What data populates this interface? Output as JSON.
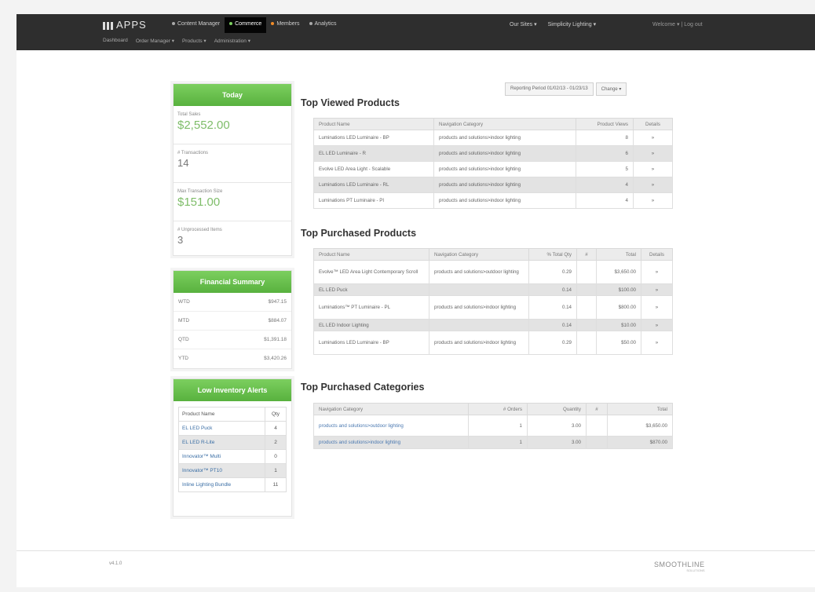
{
  "nav": {
    "logo": "APPS",
    "items": [
      {
        "label": "Content Manager",
        "dot_color": ""
      },
      {
        "label": "Commerce",
        "dot_color": "#7ccf5f",
        "active": true
      },
      {
        "label": "Members",
        "dot_color": "#f28c28"
      },
      {
        "label": "Analytics",
        "dot_color": ""
      }
    ],
    "right": [
      "Our Sites ▾",
      "Simplicity Lighting ▾"
    ],
    "user": "Welcome ▾ | Log out",
    "sub": [
      "Dashboard",
      "Order Manager ▾",
      "Products ▾",
      "Administration ▾"
    ]
  },
  "today": {
    "title": "Today",
    "stats": [
      {
        "label": "Total Sales",
        "value": "$2,552.00"
      },
      {
        "label": "# Transactions",
        "value": "14"
      },
      {
        "label": "Max Transaction Size",
        "value": "$151.00"
      },
      {
        "label": "# Unprocessed Items",
        "value": "3"
      }
    ]
  },
  "financial": {
    "title": "Financial Summary",
    "rows": [
      {
        "label": "WTD",
        "value": "$947.15"
      },
      {
        "label": "MTD",
        "value": "$884.07"
      },
      {
        "label": "QTD",
        "value": "$1,391.18"
      },
      {
        "label": "YTD",
        "value": "$3,420.26"
      }
    ]
  },
  "inventory": {
    "title": "Low Inventory Alerts",
    "col_name": "Product Name",
    "col_qty": "Qty",
    "rows": [
      {
        "name": "EL LED Puck",
        "qty": "4"
      },
      {
        "name": "EL LED R-Lite",
        "qty": "2"
      },
      {
        "name": "Innovator™ Multi",
        "qty": "0"
      },
      {
        "name": "Innovator™ PT10",
        "qty": "1"
      },
      {
        "name": "Inline Lighting Bundle",
        "qty": "11"
      }
    ]
  },
  "period": {
    "label": "Reporting Period 01/02/13 - 01/23/13",
    "change": "Change ▾"
  },
  "top_viewed": {
    "title": "Top Viewed Products",
    "headers": [
      "Product Name",
      "Navigation Category",
      "Product Views",
      "Details"
    ],
    "rows": [
      [
        "Luminations LED Luminaire - BP",
        "products and solutions>indoor lighting",
        "8",
        "»"
      ],
      [
        "EL LED Luminaire - R",
        "products and solutions>indoor lighting",
        "6",
        "»"
      ],
      [
        "Evolve LED Area Light - Scalable",
        "products and solutions>indoor lighting",
        "5",
        "»"
      ],
      [
        "Luminations LED Luminaire - RL",
        "products and solutions>indoor lighting",
        "4",
        "»"
      ],
      [
        "Luminations PT Luminaire - PI",
        "products and solutions>indoor lighting",
        "4",
        "»"
      ]
    ]
  },
  "top_purchased": {
    "title": "Top Purchased Products",
    "headers": [
      "Product Name",
      "Navigation Category",
      "% Total Qty",
      "#",
      "Total",
      "Details"
    ],
    "rows": [
      [
        "Evolve™ LED Area Light Contemporary Scroll",
        "products and solutions>outdoor lighting",
        "0.29",
        "",
        "$3,650.00",
        "»"
      ],
      [
        "EL LED Puck",
        "",
        "0.14",
        "",
        "$100.00",
        "»"
      ],
      [
        "Luminations™ PT Luminaire - PL",
        "products and solutions>indoor lighting",
        "0.14",
        "",
        "$800.00",
        "»"
      ],
      [
        "EL LED Indoor Lighting",
        "",
        "0.14",
        "",
        "$10.00",
        "»"
      ],
      [
        "Luminations LED Luminaire - BP",
        "products and solutions>indoor lighting",
        "0.29",
        "",
        "$50.00",
        "»"
      ]
    ]
  },
  "top_categories": {
    "title": "Top Purchased Categories",
    "headers": [
      "Navigation Category",
      "# Orders",
      "Quantity",
      "#",
      "Total"
    ],
    "rows": [
      [
        "products and solutions>outdoor lighting",
        "1",
        "3.00",
        "",
        "$3,650.00"
      ],
      [
        "products and solutions>indoor lighting",
        "1",
        "3.00",
        "",
        "$870.00"
      ]
    ]
  },
  "footer": {
    "version": "v4.1.0",
    "brand": "SMOOTHLINE",
    "brand_sub": "SOLUTIONS"
  }
}
